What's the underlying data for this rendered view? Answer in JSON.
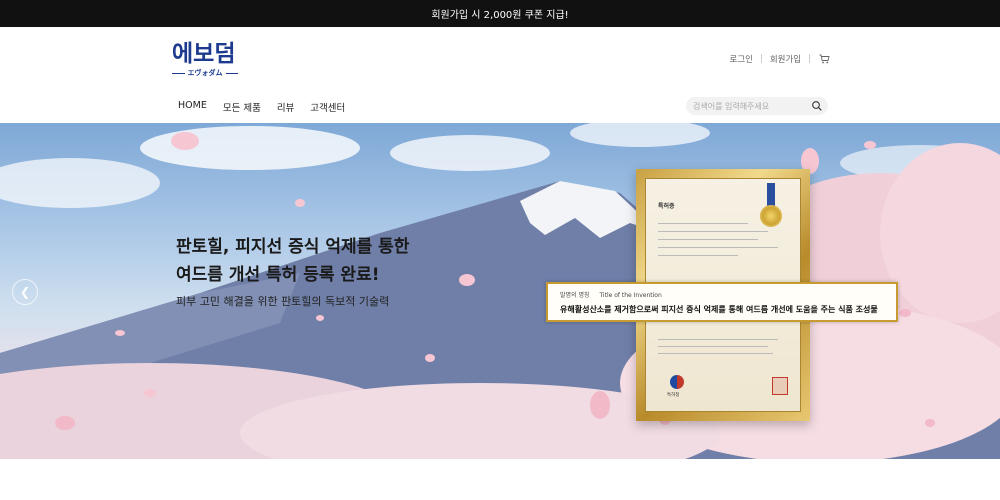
{
  "topbar": {
    "text": "회원가입 시 2,000원 쿠폰 지급!"
  },
  "logo": {
    "main": "에보덤",
    "sub": "エヴォダム"
  },
  "util": {
    "login": "로그인",
    "signup": "회원가입",
    "cart_icon": "cart-icon"
  },
  "nav": {
    "items": [
      "HOME",
      "모든 제품",
      "리뷰",
      "고객센터"
    ]
  },
  "search": {
    "placeholder": "검색어를 입력해주세요",
    "icon": "search-icon"
  },
  "hero": {
    "title_line1": "판토힐, 피지선 증식 억제를 통한",
    "title_line2": "여드름 개선 특허 등록 완료!",
    "subtitle": "피부 고민 해결을 위한 판토힐의 독보적 기술력",
    "prev_icon": "chevron-left-icon"
  },
  "certificate": {
    "title": "특허증",
    "emblem_label": "특허청",
    "banner_label_ko": "발명의 명칭",
    "banner_label_en": "Title of the Invention",
    "banner_text": "유해활성산소를 제거함으로써 피지선 증식 억제를 통해 여드름 개선에 도움을 주는 식품 조성물"
  },
  "colors": {
    "brand": "#1d3a8f",
    "topbar": "#111111",
    "frame_gold": "#c8a043"
  }
}
